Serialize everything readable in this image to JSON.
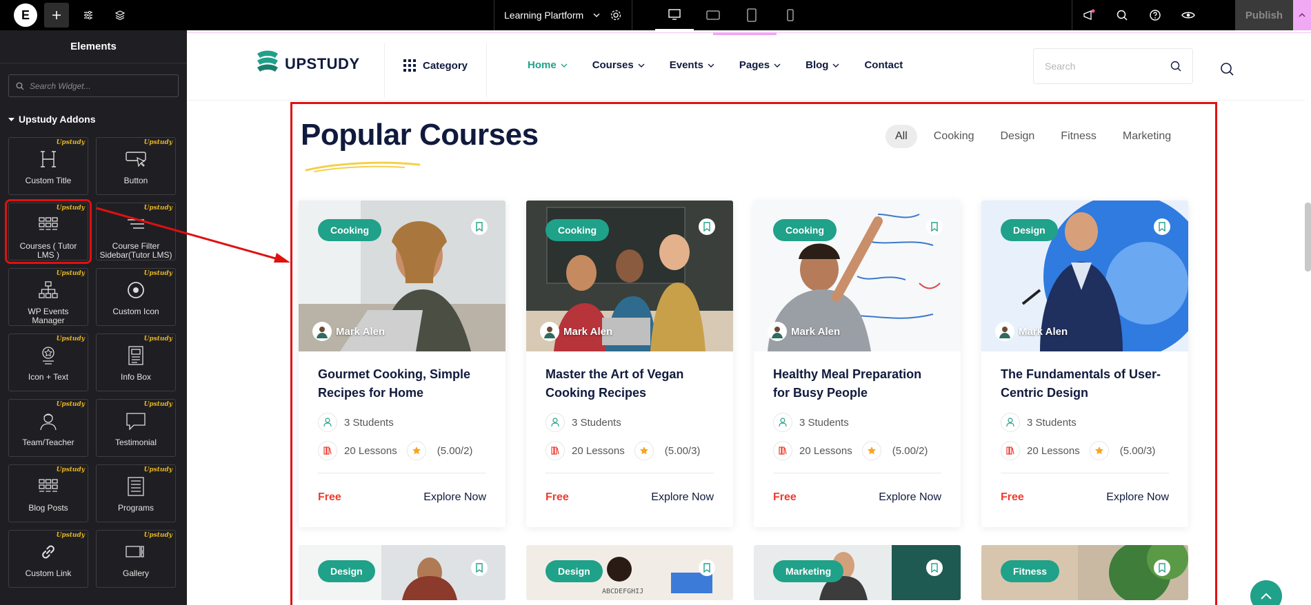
{
  "topbar": {
    "page_title": "Learning Plartform",
    "publish_label": "Publish"
  },
  "sidebar": {
    "heading": "Elements",
    "search_placeholder": "Search Widget...",
    "category": "Upstudy Addons",
    "badge": "Upstudy",
    "widgets": [
      {
        "label": "Custom Title",
        "icon": "heading-icon"
      },
      {
        "label": "Button",
        "icon": "button-icon"
      },
      {
        "label": "Courses ( Tutor LMS )",
        "icon": "grid-icon"
      },
      {
        "label": "Course Filter Sidebar(Tutor LMS)",
        "icon": "filter-icon"
      },
      {
        "label": "WP Events Manager",
        "icon": "sitemap-icon"
      },
      {
        "label": "Custom Icon",
        "icon": "target-icon"
      },
      {
        "label": "Icon + Text",
        "icon": "star-icon"
      },
      {
        "label": "Info Box",
        "icon": "info-box-icon"
      },
      {
        "label": "Team/Teacher",
        "icon": "user-icon"
      },
      {
        "label": "Testimonial",
        "icon": "comment-icon"
      },
      {
        "label": "Blog Posts",
        "icon": "grid-icon"
      },
      {
        "label": "Programs",
        "icon": "list-icon"
      },
      {
        "label": "Custom Link",
        "icon": "link-icon"
      },
      {
        "label": "Gallery",
        "icon": "gallery-icon"
      }
    ]
  },
  "site": {
    "brand": "UPSTUDY",
    "category_label": "Category",
    "nav": [
      "Home",
      "Courses",
      "Events",
      "Pages",
      "Blog",
      "Contact"
    ],
    "search_placeholder": "Search"
  },
  "section": {
    "title": "Popular Courses",
    "filters": [
      "All",
      "Cooking",
      "Design",
      "Fitness",
      "Marketing"
    ]
  },
  "courses": [
    {
      "category": "Cooking",
      "author": "Mark Alen",
      "title": "Gourmet Cooking, Simple Recipes for Home",
      "students": "3 Students",
      "lessons": "20 Lessons",
      "rating": "(5.00/2)",
      "price": "Free",
      "cta": "Explore Now"
    },
    {
      "category": "Cooking",
      "author": "Mark Alen",
      "title": "Master the Art of Vegan Cooking Recipes",
      "students": "3 Students",
      "lessons": "20 Lessons",
      "rating": "(5.00/3)",
      "price": "Free",
      "cta": "Explore Now"
    },
    {
      "category": "Cooking",
      "author": "Mark Alen",
      "title": "Healthy Meal Preparation for Busy People",
      "students": "3 Students",
      "lessons": "20 Lessons",
      "rating": "(5.00/2)",
      "price": "Free",
      "cta": "Explore Now"
    },
    {
      "category": "Design",
      "author": "Mark Alen",
      "title": "The Fundamentals of User-Centric Design",
      "students": "3 Students",
      "lessons": "20 Lessons",
      "rating": "(5.00/3)",
      "price": "Free",
      "cta": "Explore Now"
    }
  ],
  "courses_row2": [
    {
      "category": "Design"
    },
    {
      "category": "Design"
    },
    {
      "category": "Marketing"
    },
    {
      "category": "Fitness"
    }
  ],
  "colors": {
    "accent": "#20a189",
    "highlight": "#e01010",
    "price": "#f03a2e",
    "navy": "#101a3d"
  }
}
